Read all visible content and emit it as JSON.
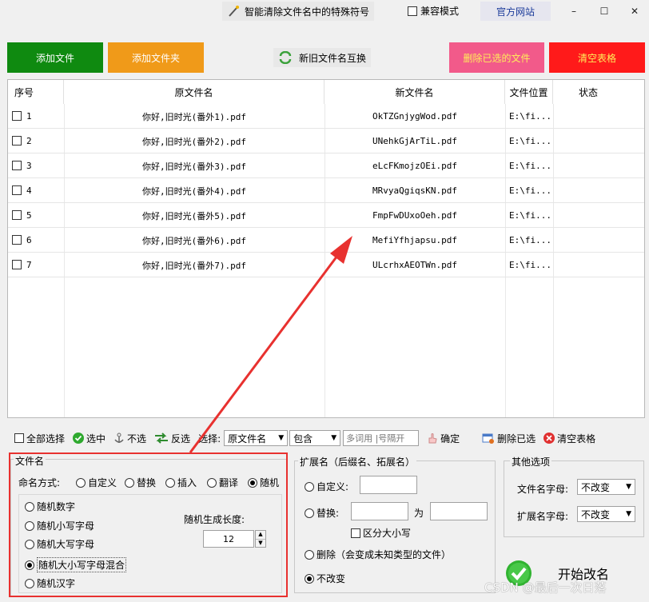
{
  "titlebar": {
    "title": "智能清除文件名中的特殊符号",
    "compat_label": "兼容模式",
    "official_label": "官方网站",
    "minimize": "–",
    "maximize": "☐",
    "close": "✕"
  },
  "topbuttons": {
    "add_file": "添加文件",
    "add_folder": "添加文件夹",
    "swap": "新旧文件名互换",
    "delete_selected": "删除已选的文件",
    "clear_table": "清空表格"
  },
  "colors": {
    "green": "#0f8a10",
    "orange": "#f09a19",
    "pink": "#f25a8a",
    "red": "#ff1a1a",
    "accent_red": "#e8312f"
  },
  "table": {
    "headers": [
      "序号",
      "原文件名",
      "新文件名",
      "文件位置",
      "状态"
    ],
    "rows": [
      {
        "no": "1",
        "orig": "你好,旧时光(番外1).pdf",
        "new": "OkTZGnjygWod.pdf",
        "loc": "E:\\fi...",
        "status": ""
      },
      {
        "no": "2",
        "orig": "你好,旧时光(番外2).pdf",
        "new": "UNehkGjArTiL.pdf",
        "loc": "E:\\fi...",
        "status": ""
      },
      {
        "no": "3",
        "orig": "你好,旧时光(番外3).pdf",
        "new": "eLcFKmojzOEi.pdf",
        "loc": "E:\\fi...",
        "status": ""
      },
      {
        "no": "4",
        "orig": "你好,旧时光(番外4).pdf",
        "new": "MRvyaQgiqsKN.pdf",
        "loc": "E:\\fi...",
        "status": ""
      },
      {
        "no": "5",
        "orig": "你好,旧时光(番外5).pdf",
        "new": "FmpFwDUxoOeh.pdf",
        "loc": "E:\\fi...",
        "status": ""
      },
      {
        "no": "6",
        "orig": "你好,旧时光(番外6).pdf",
        "new": "MefiYfhjapsu.pdf",
        "loc": "E:\\fi...",
        "status": ""
      },
      {
        "no": "7",
        "orig": "你好,旧时光(番外7).pdf",
        "new": "ULcrhxAEOTWn.pdf",
        "loc": "E:\\fi...",
        "status": ""
      }
    ]
  },
  "toolbar": {
    "select_all": "全部选择",
    "select": "选中",
    "unselect": "不选",
    "invert": "反选",
    "choose_label": "选择:",
    "field_value": "原文件名",
    "match_value": "包含",
    "keyword_placeholder": "多词用 |号隔开",
    "confirm": "确定",
    "delete_selected": "删除已选",
    "clear_table": "清空表格"
  },
  "filename": {
    "group": "文件名",
    "mode_label": "命名方式:",
    "modes": [
      "自定义",
      "替换",
      "插入",
      "翻译",
      "随机"
    ],
    "random_options": [
      "随机数字",
      "随机小写字母",
      "随机大写字母",
      "随机大小写字母混合",
      "随机汉字"
    ],
    "length_label": "随机生成长度:",
    "length_value": "12"
  },
  "ext": {
    "group": "扩展名（后缀名、拓展名）",
    "custom": "自定义:",
    "replace": "替换:",
    "to": "为",
    "case": "区分大小写",
    "delete": "删除（会变成未知类型的文件）",
    "nochange": "不改变"
  },
  "other": {
    "group": "其他选项",
    "fname_case_label": "文件名字母:",
    "fname_case_value": "不改变",
    "ext_case_label": "扩展名字母:",
    "ext_case_value": "不改变"
  },
  "start": {
    "label": "开始改名"
  },
  "watermark": "CSDN @最后一次日落"
}
